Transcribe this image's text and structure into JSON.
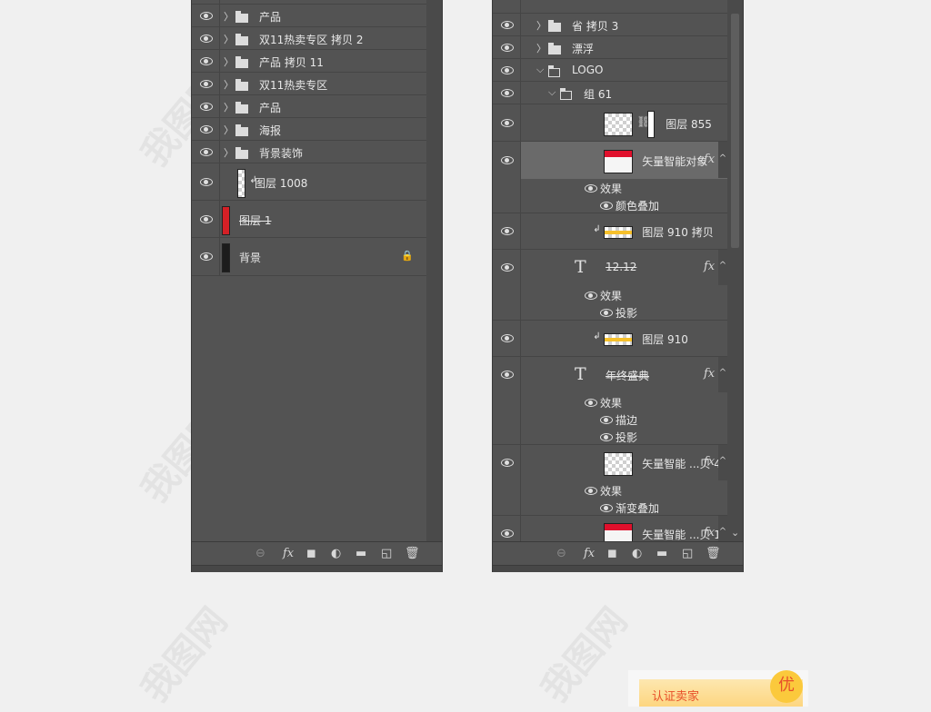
{
  "left_panel": {
    "rows": [
      {
        "type": "partial",
        "label": "",
        "h": 5
      },
      {
        "type": "group",
        "label": "产品",
        "h": 25
      },
      {
        "type": "group",
        "label": "双11热卖专区 拷贝 2",
        "h": 25
      },
      {
        "type": "group",
        "label": "产品 拷贝 11",
        "h": 25
      },
      {
        "type": "group",
        "label": "双11热卖专区",
        "h": 25
      },
      {
        "type": "group",
        "label": "产品",
        "h": 25
      },
      {
        "type": "group",
        "label": "海报",
        "h": 25
      },
      {
        "type": "group",
        "label": "背景装饰",
        "h": 25
      },
      {
        "type": "layer",
        "label": "图层 1008",
        "h": 41,
        "clip": true,
        "thumb": "checker-tall",
        "indent": 1
      },
      {
        "type": "layer",
        "label": "图层 1",
        "h": 41,
        "thumb": "red",
        "strike": true
      },
      {
        "type": "layer",
        "label": "背景",
        "h": 42,
        "thumb": "dark",
        "locked": true
      }
    ],
    "scroll_position": 0
  },
  "right_panel": {
    "rows": [
      {
        "type": "partial",
        "label": "",
        "h": 15
      },
      {
        "type": "group",
        "label": "省 拷贝 3",
        "h": 25,
        "indent": 1
      },
      {
        "type": "group",
        "label": "漂浮",
        "h": 25,
        "indent": 1
      },
      {
        "type": "group",
        "label": "LOGO",
        "h": 25,
        "indent": 1,
        "open": true
      },
      {
        "type": "group",
        "label": "组 61",
        "h": 25,
        "indent": 2,
        "open": true
      },
      {
        "type": "layer",
        "label": "图层 855",
        "h": 41,
        "thumb": "checker",
        "mask": true,
        "indent": 3
      },
      {
        "type": "layer",
        "label": "矢量智能对象",
        "h": 41,
        "thumb": "smart-red",
        "fx": true,
        "selected": true,
        "indent": 3,
        "effects_title": "效果",
        "effects": [
          "颜色叠加"
        ]
      },
      {
        "type": "layer",
        "label": "图层 910 拷贝",
        "h": 40,
        "thumb": "yellow",
        "clip": true,
        "indent": 3
      },
      {
        "type": "text",
        "label": "12.12",
        "h": 40,
        "fx": true,
        "strike": true,
        "indent": 3,
        "effects_title": "效果",
        "effects": [
          "投影"
        ]
      },
      {
        "type": "layer",
        "label": "图层 910",
        "h": 40,
        "thumb": "yellow",
        "clip": true,
        "indent": 3
      },
      {
        "type": "text",
        "label": "年终盛典",
        "h": 40,
        "fx": true,
        "strike": true,
        "indent": 3,
        "effects_title": "效果",
        "effects": [
          "描边",
          "投影"
        ]
      },
      {
        "type": "layer",
        "label": "矢量智能 ...贝 4",
        "h": 40,
        "thumb": "checker",
        "fx": true,
        "indent": 3,
        "effects_title": "效果",
        "effects": [
          "渐变叠加"
        ]
      },
      {
        "type": "layer",
        "label": "矢量智能 ...贝 10",
        "h": 40,
        "thumb": "smart-red",
        "fx": true,
        "indent": 3
      }
    ],
    "scroll_position": 0.0
  },
  "footer_icons": [
    "link-icon",
    "fx-icon",
    "mask-icon",
    "adjustment-icon",
    "folder-icon",
    "new-layer-icon",
    "trash-icon"
  ],
  "footer_glyphs": [
    "⊖",
    "fx",
    "◼",
    "◐",
    "▬",
    "◱",
    "🗑"
  ],
  "card": {
    "label": "认证卖家",
    "badge": "优"
  },
  "watermark": "我图网"
}
